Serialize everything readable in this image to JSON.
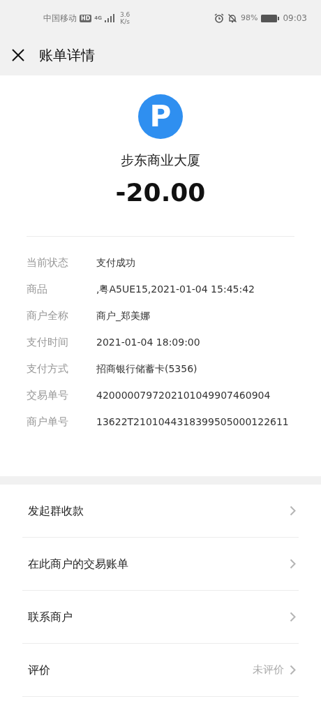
{
  "status_bar": {
    "carrier": "中国移动",
    "hd": "HD",
    "network": "4G",
    "speed_value": "3.6",
    "speed_unit": "K/s",
    "battery_percent": "98%",
    "time": "09:03"
  },
  "header": {
    "title": "账单详情"
  },
  "merchant": {
    "logo_letter": "P",
    "name": "步东商业大厦",
    "amount": "-20.00"
  },
  "details": [
    {
      "label": "当前状态",
      "value": "支付成功"
    },
    {
      "label": "商品",
      "value": ",粤A5UE15,2021-01-04 15:45:42"
    },
    {
      "label": "商户全称",
      "value": "商户_郑美娜"
    },
    {
      "label": "支付时间",
      "value": "2021-01-04 18:09:00"
    },
    {
      "label": "支付方式",
      "value": "招商银行储蓄卡(5356)"
    },
    {
      "label": "交易单号",
      "value": "4200000797202101049907460904"
    },
    {
      "label": "商户单号",
      "value": "13622T2101044318399505000122611"
    }
  ],
  "actions": [
    {
      "label": "发起群收款"
    },
    {
      "label": "在此商户的交易账单"
    },
    {
      "label": "联系商户"
    },
    {
      "label": "评价",
      "status": "未评价"
    }
  ]
}
